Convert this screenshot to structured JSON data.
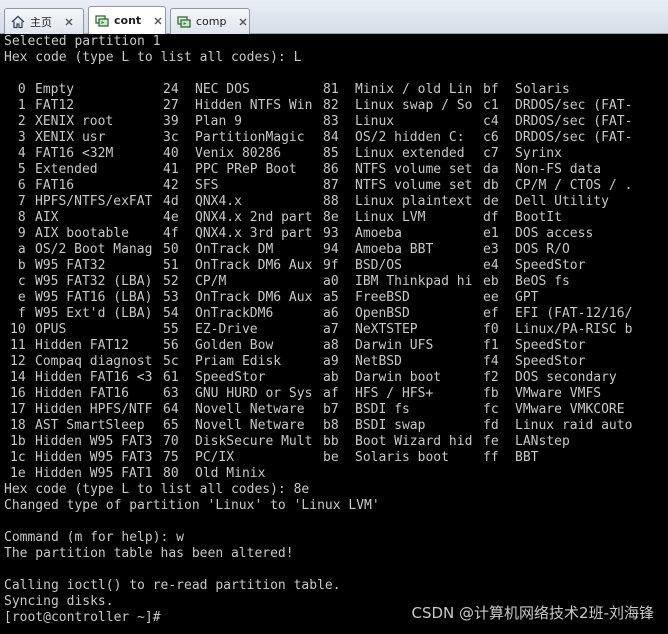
{
  "tabs": [
    {
      "label": "主页",
      "icon": "home-icon",
      "active": false
    },
    {
      "label": "cont",
      "icon": "vm-icon",
      "active": true
    },
    {
      "label": "comp",
      "icon": "vm-icon",
      "active": false
    }
  ],
  "terminal": {
    "header_lines": [
      "Selected partition 1",
      "Hex code (type L to list all codes): L"
    ],
    "partition_codes": [
      [
        " 0",
        "Empty"
      ],
      [
        "24",
        "NEC DOS"
      ],
      [
        "81",
        "Minix / old Lin"
      ],
      [
        "bf",
        "Solaris"
      ],
      [
        " 1",
        "FAT12"
      ],
      [
        "27",
        "Hidden NTFS Win"
      ],
      [
        "82",
        "Linux swap / So"
      ],
      [
        "c1",
        "DRDOS/sec (FAT-"
      ],
      [
        " 2",
        "XENIX root"
      ],
      [
        "39",
        "Plan 9"
      ],
      [
        "83",
        "Linux"
      ],
      [
        "c4",
        "DRDOS/sec (FAT-"
      ],
      [
        " 3",
        "XENIX usr"
      ],
      [
        "3c",
        "PartitionMagic"
      ],
      [
        "84",
        "OS/2 hidden C:"
      ],
      [
        "c6",
        "DRDOS/sec (FAT-"
      ],
      [
        " 4",
        "FAT16 <32M"
      ],
      [
        "40",
        "Venix 80286"
      ],
      [
        "85",
        "Linux extended"
      ],
      [
        "c7",
        "Syrinx"
      ],
      [
        " 5",
        "Extended"
      ],
      [
        "41",
        "PPC PReP Boot"
      ],
      [
        "86",
        "NTFS volume set"
      ],
      [
        "da",
        "Non-FS data"
      ],
      [
        " 6",
        "FAT16"
      ],
      [
        "42",
        "SFS"
      ],
      [
        "87",
        "NTFS volume set"
      ],
      [
        "db",
        "CP/M / CTOS / ."
      ],
      [
        " 7",
        "HPFS/NTFS/exFAT"
      ],
      [
        "4d",
        "QNX4.x"
      ],
      [
        "88",
        "Linux plaintext"
      ],
      [
        "de",
        "Dell Utility"
      ],
      [
        " 8",
        "AIX"
      ],
      [
        "4e",
        "QNX4.x 2nd part"
      ],
      [
        "8e",
        "Linux LVM"
      ],
      [
        "df",
        "BootIt"
      ],
      [
        " 9",
        "AIX bootable"
      ],
      [
        "4f",
        "QNX4.x 3rd part"
      ],
      [
        "93",
        "Amoeba"
      ],
      [
        "e1",
        "DOS access"
      ],
      [
        " a",
        "OS/2 Boot Manag"
      ],
      [
        "50",
        "OnTrack DM"
      ],
      [
        "94",
        "Amoeba BBT"
      ],
      [
        "e3",
        "DOS R/O"
      ],
      [
        " b",
        "W95 FAT32"
      ],
      [
        "51",
        "OnTrack DM6 Aux"
      ],
      [
        "9f",
        "BSD/OS"
      ],
      [
        "e4",
        "SpeedStor"
      ],
      [
        " c",
        "W95 FAT32 (LBA)"
      ],
      [
        "52",
        "CP/M"
      ],
      [
        "a0",
        "IBM Thinkpad hi"
      ],
      [
        "eb",
        "BeOS fs"
      ],
      [
        " e",
        "W95 FAT16 (LBA)"
      ],
      [
        "53",
        "OnTrack DM6 Aux"
      ],
      [
        "a5",
        "FreeBSD"
      ],
      [
        "ee",
        "GPT"
      ],
      [
        " f",
        "W95 Ext'd (LBA)"
      ],
      [
        "54",
        "OnTrackDM6"
      ],
      [
        "a6",
        "OpenBSD"
      ],
      [
        "ef",
        "EFI (FAT-12/16/"
      ],
      [
        "10",
        "OPUS"
      ],
      [
        "55",
        "EZ-Drive"
      ],
      [
        "a7",
        "NeXTSTEP"
      ],
      [
        "f0",
        "Linux/PA-RISC b"
      ],
      [
        "11",
        "Hidden FAT12"
      ],
      [
        "56",
        "Golden Bow"
      ],
      [
        "a8",
        "Darwin UFS"
      ],
      [
        "f1",
        "SpeedStor"
      ],
      [
        "12",
        "Compaq diagnost"
      ],
      [
        "5c",
        "Priam Edisk"
      ],
      [
        "a9",
        "NetBSD"
      ],
      [
        "f4",
        "SpeedStor"
      ],
      [
        "14",
        "Hidden FAT16 <3"
      ],
      [
        "61",
        "SpeedStor"
      ],
      [
        "ab",
        "Darwin boot"
      ],
      [
        "f2",
        "DOS secondary"
      ],
      [
        "16",
        "Hidden FAT16"
      ],
      [
        "63",
        "GNU HURD or Sys"
      ],
      [
        "af",
        "HFS / HFS+"
      ],
      [
        "fb",
        "VMware VMFS"
      ],
      [
        "17",
        "Hidden HPFS/NTF"
      ],
      [
        "64",
        "Novell Netware"
      ],
      [
        "b7",
        "BSDI fs"
      ],
      [
        "fc",
        "VMware VMKCORE"
      ],
      [
        "18",
        "AST SmartSleep"
      ],
      [
        "65",
        "Novell Netware"
      ],
      [
        "b8",
        "BSDI swap"
      ],
      [
        "fd",
        "Linux raid auto"
      ],
      [
        "1b",
        "Hidden W95 FAT3"
      ],
      [
        "70",
        "DiskSecure Mult"
      ],
      [
        "bb",
        "Boot Wizard hid"
      ],
      [
        "fe",
        "LANstep"
      ],
      [
        "1c",
        "Hidden W95 FAT3"
      ],
      [
        "75",
        "PC/IX"
      ],
      [
        "be",
        "Solaris boot"
      ],
      [
        "ff",
        "BBT"
      ],
      [
        "1e",
        "Hidden W95 FAT1"
      ],
      [
        "80",
        "Old Minix"
      ]
    ],
    "footer_lines": [
      "Hex code (type L to list all codes): 8e",
      "Changed type of partition 'Linux' to 'Linux LVM'",
      "",
      "Command (m for help): w",
      "The partition table has been altered!",
      "",
      "Calling ioctl() to re-read partition table.",
      "Syncing disks.",
      "[root@controller ~]#"
    ]
  },
  "watermark": "CSDN @计算机网络技术2班-刘海锋"
}
